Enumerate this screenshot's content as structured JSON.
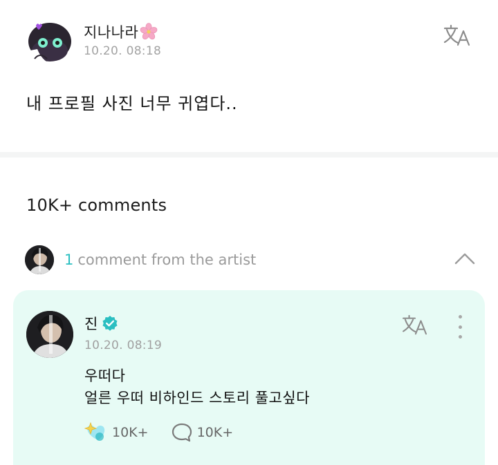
{
  "post": {
    "username": "지나나라",
    "username_emoji_icon": "cherry-blossom-icon",
    "timestamp": "10.20. 08:18",
    "text": "내 프로필 사진 너무 귀엽다..",
    "translate_icon": "translate-icon"
  },
  "comments": {
    "count_label": "10K+ comments",
    "artist_summary": {
      "count": "1",
      "label": "comment from the artist",
      "collapse_icon": "chevron-up-icon"
    },
    "artist_comment": {
      "name": "진",
      "verified_icon": "verified-badge-icon",
      "timestamp": "10.20. 08:19",
      "lines": [
        "우떠다",
        "얼른 우떠 비하인드 스토리 풀고싶다"
      ],
      "like_count": "10K+",
      "reply_count": "10K+",
      "like_icon": "sparkle-heart-icon",
      "reply_icon": "speech-bubble-icon",
      "more_icon": "more-vertical-icon"
    }
  },
  "colors": {
    "accent": "#2bbfc1",
    "card_background": "#e7fbf5",
    "muted_text": "#a0a0a0",
    "verified": "#2bbfc1"
  }
}
